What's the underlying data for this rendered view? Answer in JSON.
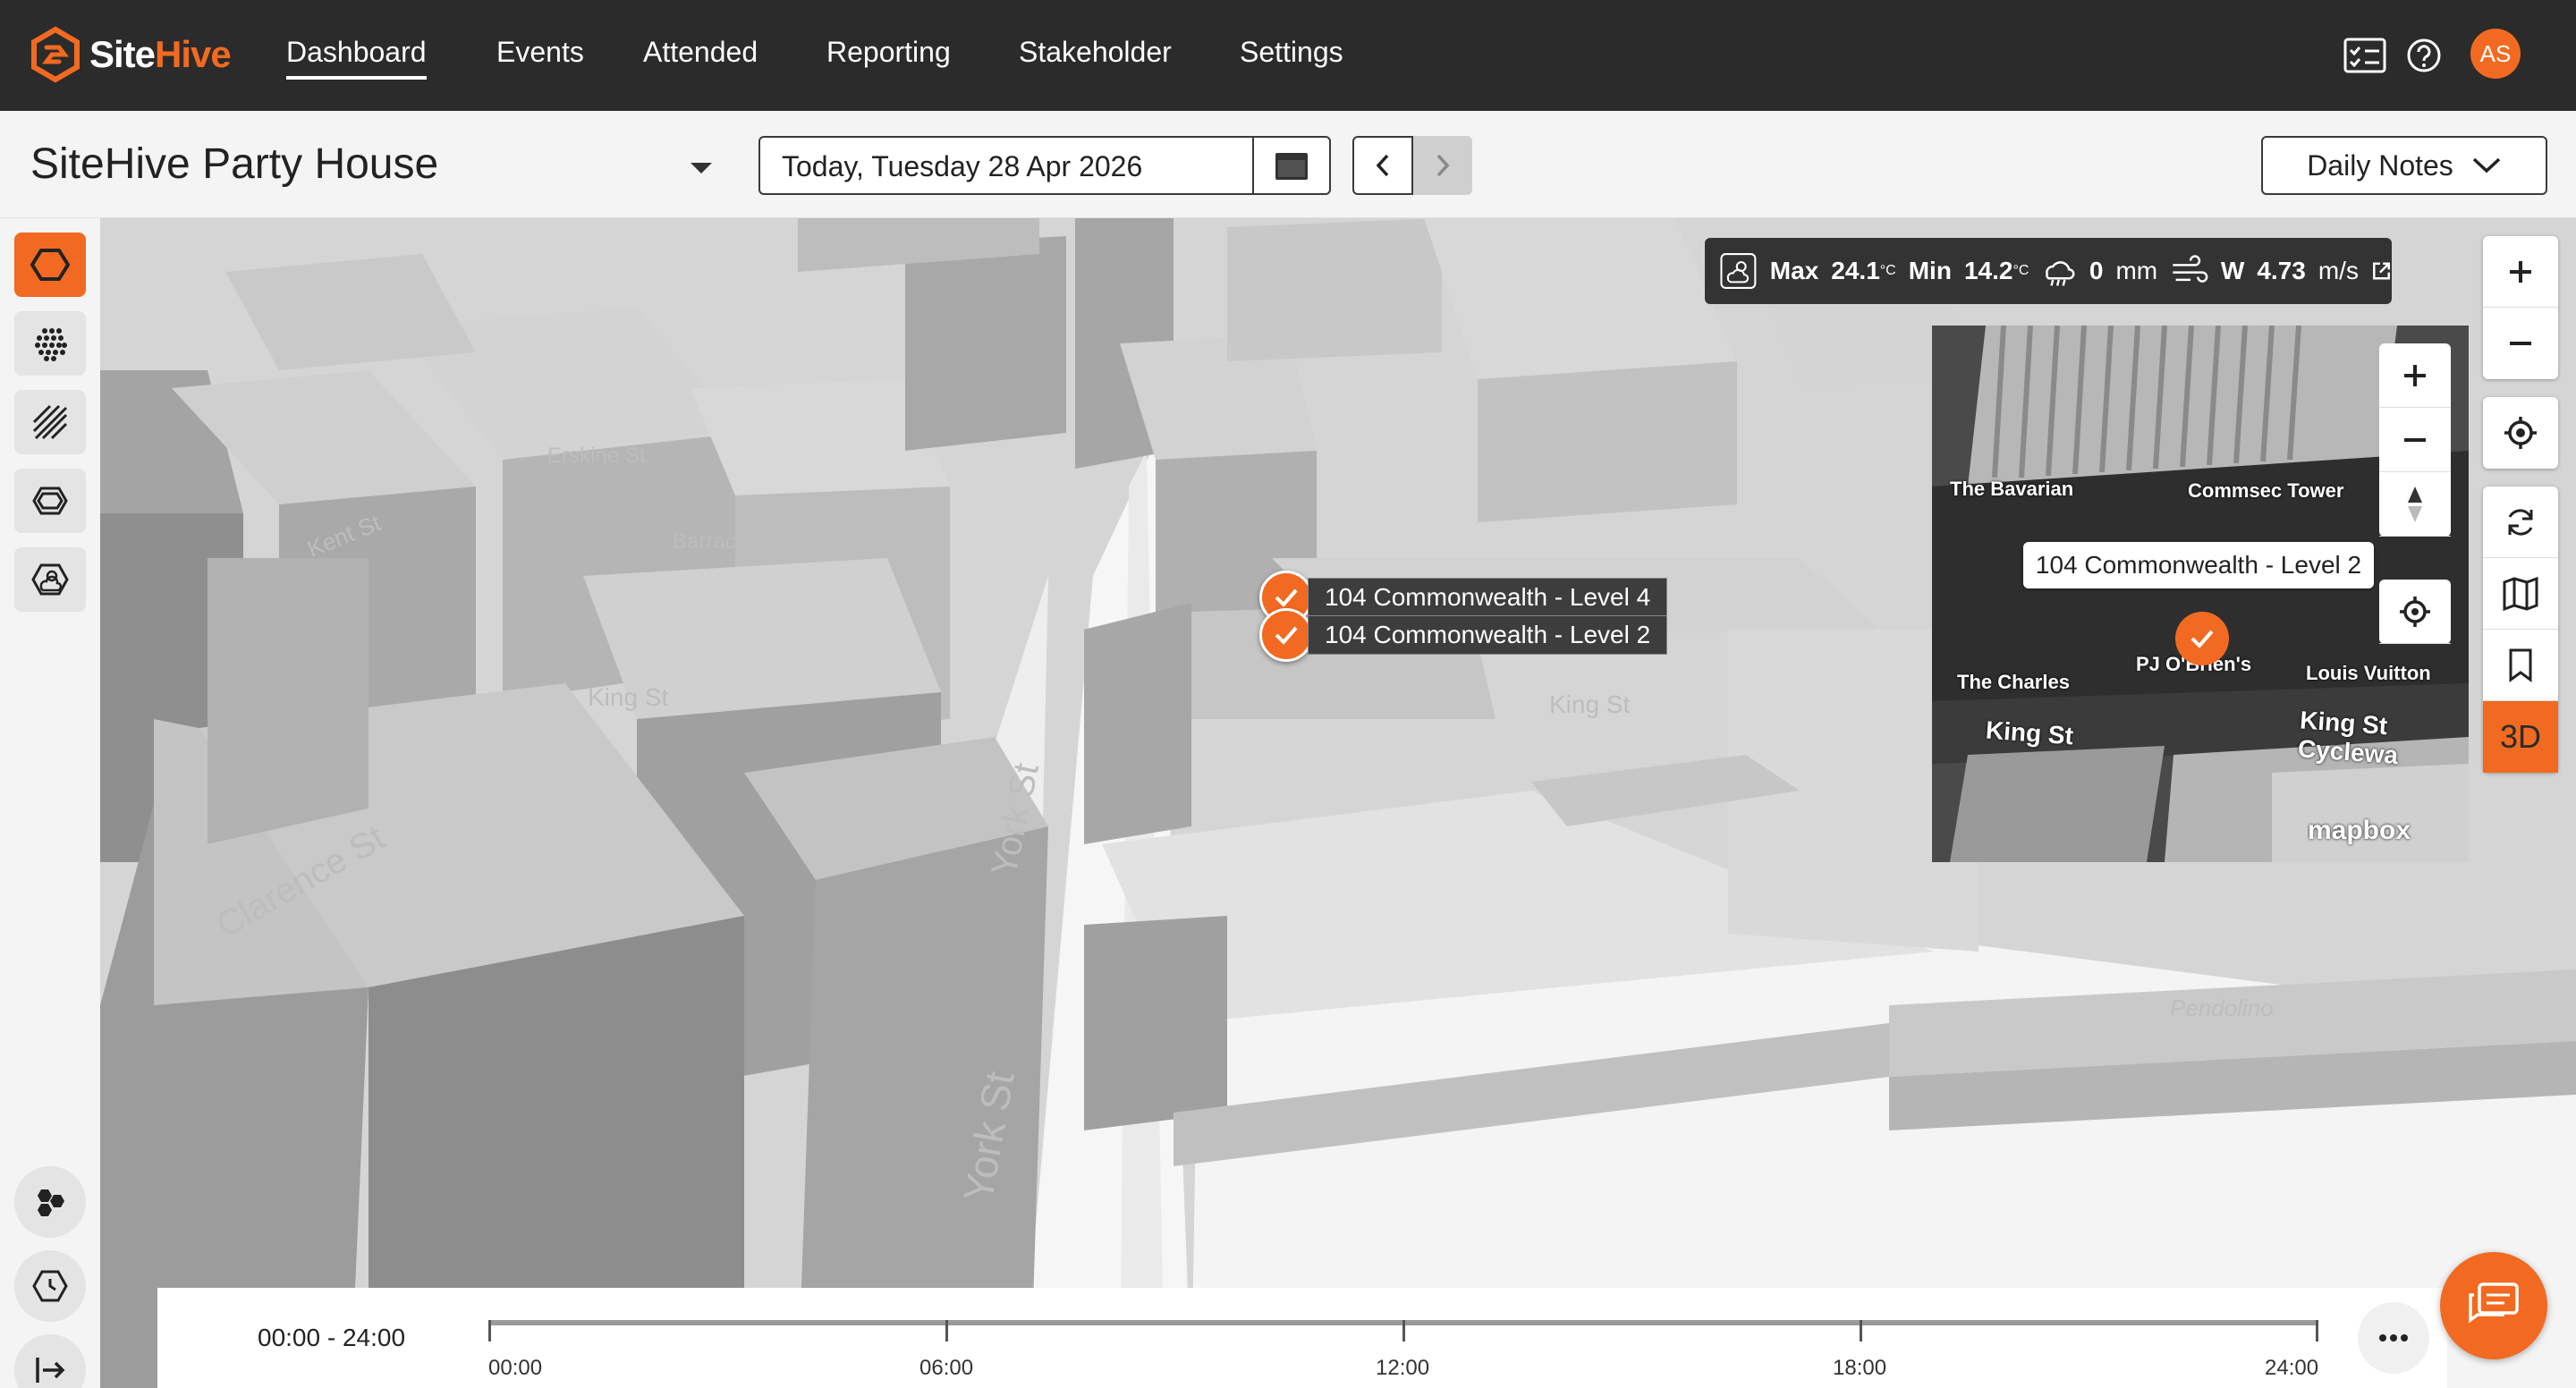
{
  "brand": {
    "name_a": "Site",
    "name_b": "Hive",
    "accent": "#f26a21"
  },
  "nav": {
    "items": [
      {
        "label": "Dashboard",
        "active": true
      },
      {
        "label": "Events"
      },
      {
        "label": "Attended"
      },
      {
        "label": "Reporting"
      },
      {
        "label": "Stakeholder"
      },
      {
        "label": "Settings"
      }
    ],
    "icons": [
      "checklist-icon",
      "help-icon"
    ],
    "avatar": "AS"
  },
  "header": {
    "site_name": "SiteHive Party House",
    "date": "Today, Tuesday 28 Apr 2026",
    "notes_label": "Daily Notes"
  },
  "weather": {
    "max_label": "Max",
    "max_value": "24.1",
    "min_label": "Min",
    "min_value": "14.2",
    "unit": "°C",
    "rain": "0",
    "rain_unit": "mm",
    "wind_label": "W",
    "wind": "4.73",
    "wind_unit": "m/s"
  },
  "map": {
    "mode_label": "3D",
    "markers": [
      {
        "label": "104 Commonwealth - Level 4"
      },
      {
        "label": "104 Commonwealth - Level 2"
      }
    ],
    "streets": [
      "Kent St",
      "Clarence St",
      "York St",
      "York St",
      "King St",
      "King St",
      "Erskine St",
      "Barrack St",
      "Pendolino"
    ]
  },
  "minimap": {
    "tooltip": "104 Commonwealth - Level 2",
    "labels": [
      "The Bavarian",
      "Commsec Tower",
      "The Charles",
      "PJ O'Brien's",
      "Louis Vuitton"
    ],
    "roads": [
      "King St",
      "King St Cyclewa"
    ],
    "attribution": "mapbox"
  },
  "timeline": {
    "range": "00:00 - 24:00",
    "ticks": [
      "00:00",
      "06:00",
      "12:00",
      "18:00",
      "24:00"
    ]
  }
}
